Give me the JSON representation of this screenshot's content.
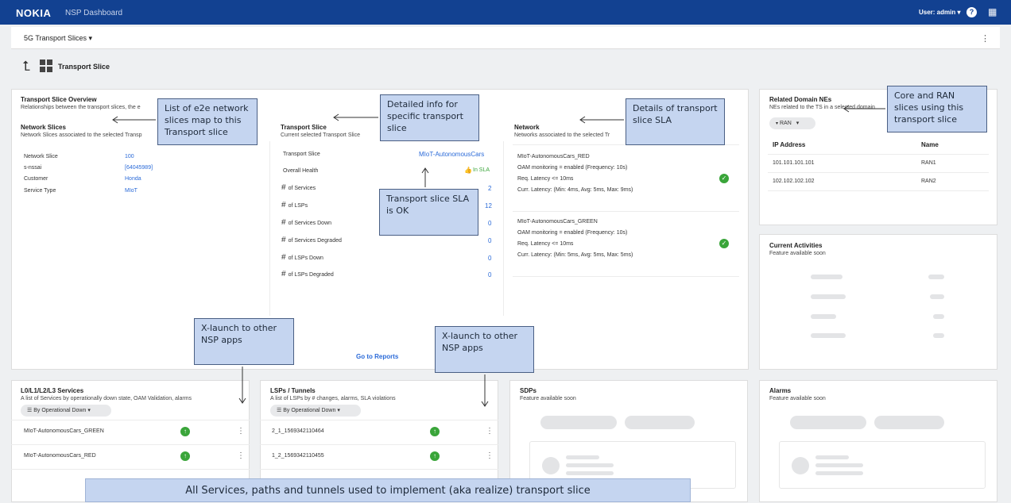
{
  "app": {
    "logo": "NOKIA",
    "title": "NSP Dashboard",
    "user": "User: admin ▾",
    "help": "?",
    "grid_icon": "apps-grid-icon"
  },
  "subbar": {
    "dropdown": "5G Transport Slices  ▾",
    "menu_icon": "kebab-icon"
  },
  "page": {
    "title": "Transport Slice"
  },
  "overview": {
    "title": "Transport Slice Overview",
    "subtitle": "Relationships between the transport slices, the e",
    "section_title": "Network Slices",
    "section_sub": "Network Slices associated to the selected Transp",
    "fields": [
      {
        "label": "Network Slice",
        "value": "100"
      },
      {
        "label": "s-nssai",
        "value": "[64045989]"
      },
      {
        "label": "Customer",
        "value": "Honda"
      },
      {
        "label": "Service Type",
        "value": "MIoT"
      }
    ]
  },
  "transport": {
    "title": "Transport Slice",
    "subtitle": "Current selected Transport Slice",
    "slice_label": "Transport Slice",
    "slice_value": "MIoT-AutonomousCars",
    "health_label": "Overall Health",
    "health_value": "In SLA",
    "metrics": [
      {
        "label": "of Services",
        "value": "2"
      },
      {
        "label": "of LSPs",
        "value": "12"
      },
      {
        "label": "of Services Down",
        "value": "0"
      },
      {
        "label": "of Services Degraded",
        "value": "0"
      },
      {
        "label": "of LSPs Down",
        "value": "0"
      },
      {
        "label": "of LSPs Degraded",
        "value": "0"
      }
    ],
    "reports_link": "Go to Reports"
  },
  "network": {
    "title": "Network",
    "subtitle": "Networks associated to the selected Tr",
    "items": [
      {
        "name": "MIoT-AutonomousCars_RED",
        "oam": "OAM monitoring = enabled (Frequency: 10s)",
        "req": "Req. Latency <= 10ms",
        "curr": "Curr. Latency: (Min: 4ms, Avg: 5ms, Max: 9ms)"
      },
      {
        "name": "MIoT-AutonomousCars_GREEN",
        "oam": "OAM monitoring = enabled (Frequency: 10s)",
        "req": "Req. Latency <= 10ms",
        "curr": "Curr. Latency: (Min: 5ms, Avg: 5ms, Max: 5ms)"
      }
    ]
  },
  "related": {
    "title": "Related Domain NEs",
    "subtitle": "NEs related to the TS in a selected domain",
    "filter": "RAN",
    "col_ip": "IP Address",
    "col_name": "Name",
    "rows": [
      {
        "ip": "101.101.101.101",
        "name": "RAN1"
      },
      {
        "ip": "102.102.102.102",
        "name": "RAN2"
      }
    ]
  },
  "activities": {
    "title": "Current Activities",
    "subtitle": "Feature available soon"
  },
  "services": {
    "title": "L0/L1/L2/L3 Services",
    "subtitle": "A list of Services by operationally down state, OAM Validation, alarms",
    "filter": "By Operational Down",
    "rows": [
      "MIoT-AutonomousCars_GREEN",
      "MIoT-AutonomousCars_RED"
    ]
  },
  "lsps": {
    "title": "LSPs / Tunnels",
    "subtitle": "A list of LSPs by # changes, alarms, SLA violations",
    "filter": "By Operational Down",
    "rows": [
      "2_1_1569342110464",
      "1_2_1569342110455"
    ]
  },
  "sdps": {
    "title": "SDPs",
    "subtitle": "Feature available soon"
  },
  "alarms": {
    "title": "Alarms",
    "subtitle": "Feature available soon"
  },
  "callouts": {
    "c1": "List of e2e network slices map to this Transport slice",
    "c2": "Detailed info for specific transport slice",
    "c3": "Details of transport slice SLA",
    "c4": "Core and RAN slices using this transport slice",
    "c5": "Transport slice SLA is OK",
    "c6": "X-launch to other NSP apps",
    "c7": "X-launch to other NSP apps"
  },
  "banner": "All Services, paths and tunnels used to implement (aka realize) transport slice"
}
